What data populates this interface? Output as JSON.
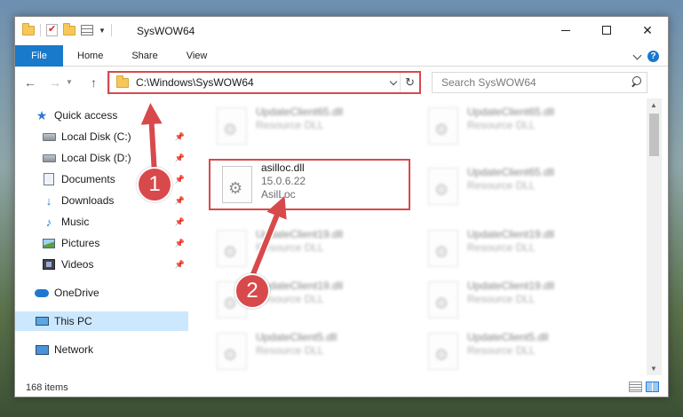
{
  "window": {
    "title": "SysWOW64"
  },
  "ribbon": {
    "tabs": [
      {
        "label": "File"
      },
      {
        "label": "Home"
      },
      {
        "label": "Share"
      },
      {
        "label": "View"
      }
    ]
  },
  "address": {
    "path": "C:\\Windows\\SysWOW64",
    "search_placeholder": "Search SysWOW64"
  },
  "nav_pane": {
    "items": [
      {
        "label": "Quick access",
        "icon": "star-icon"
      },
      {
        "label": "Local Disk (C:)",
        "icon": "drive-icon",
        "pinned": true
      },
      {
        "label": "Local Disk (D:)",
        "icon": "drive-icon",
        "pinned": true
      },
      {
        "label": "Documents",
        "icon": "documents-icon",
        "pinned": true
      },
      {
        "label": "Downloads",
        "icon": "downloads-icon",
        "pinned": true
      },
      {
        "label": "Music",
        "icon": "music-icon",
        "pinned": true
      },
      {
        "label": "Pictures",
        "icon": "pictures-icon",
        "pinned": true
      },
      {
        "label": "Videos",
        "icon": "videos-icon",
        "pinned": true
      },
      {
        "label": "OneDrive",
        "icon": "onedrive-icon"
      },
      {
        "label": "This PC",
        "icon": "this-pc-icon",
        "selected": true
      },
      {
        "label": "Network",
        "icon": "network-icon"
      }
    ]
  },
  "files": {
    "left_column": [
      {
        "name": "UpdateClient65.dll",
        "sub": "Resource DLL",
        "blurred": true
      },
      {
        "name": "asilloc.dll",
        "version": "15.0.6.22",
        "sub": "AsilLoc",
        "blurred": false,
        "highlighted": true
      },
      {
        "name": "UpdateClient19.dll",
        "sub": "Resource DLL",
        "blurred": true
      },
      {
        "name": "UpdateClient19.dll",
        "sub": "Resource DLL",
        "blurred": true
      },
      {
        "name": "UpdateClient5.dll",
        "sub": "Resource DLL",
        "blurred": true
      }
    ],
    "right_column": [
      {
        "name": "UpdateClient65.dll",
        "sub": "Resource DLL",
        "blurred": true
      },
      {
        "name": "UpdateClient65.dll",
        "sub": "Resource DLL",
        "blurred": true
      },
      {
        "name": "UpdateClient19.dll",
        "sub": "Resource DLL",
        "blurred": true
      },
      {
        "name": "UpdateClient19.dll",
        "sub": "Resource DLL",
        "blurred": true
      },
      {
        "name": "UpdateClient5.dll",
        "sub": "Resource DLL",
        "blurred": true
      }
    ]
  },
  "status": {
    "item_count": "168 items"
  },
  "annotations": {
    "step1": "1",
    "step2": "2",
    "color": "#d8494c"
  }
}
